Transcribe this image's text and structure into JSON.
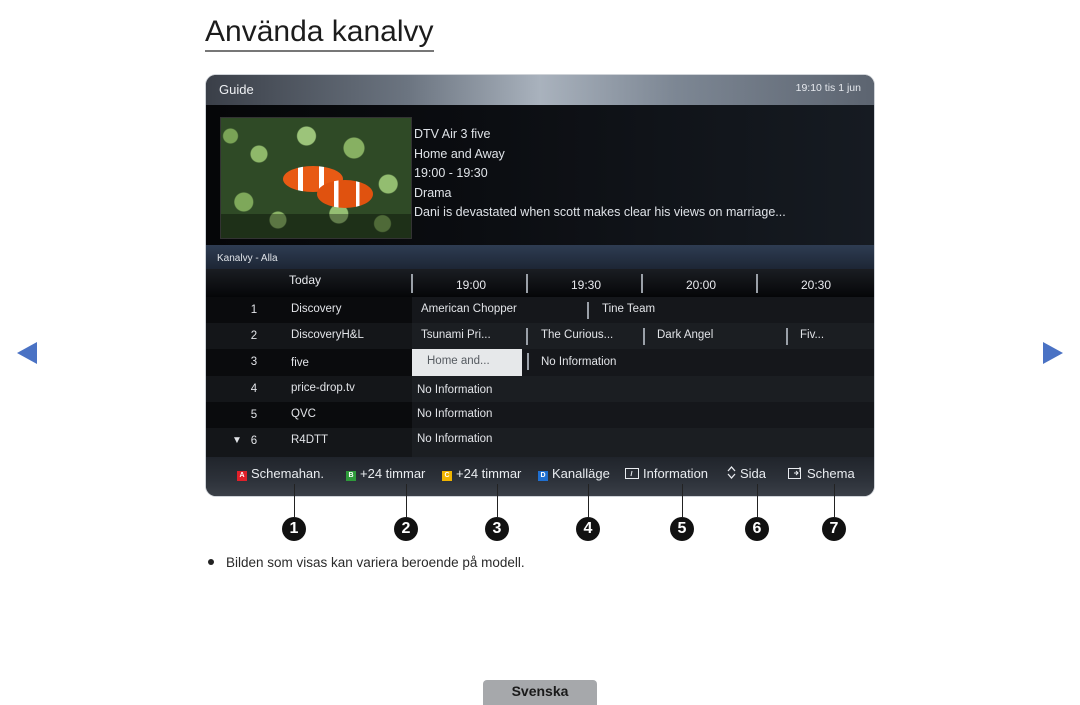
{
  "page": {
    "title": "Använda kanalvy",
    "note": "Bilden som visas kan variera beroende på modell.",
    "language_tab": "Svenska",
    "nav": {
      "prev": "previous-page",
      "next": "next-page"
    }
  },
  "guide": {
    "title": "Guide",
    "clock": "19:10 tis 1 jun",
    "program_info": {
      "channel": "DTV Air 3 five",
      "program": "Home and Away",
      "time": "19:00 - 19:30",
      "genre": "Drama",
      "description": "Dani is devastated when scott makes clear his views on marriage..."
    },
    "list_title": "Kanalvy - Alla",
    "day_label": "Today",
    "times": [
      "19:00",
      "19:30",
      "20:00",
      "20:30"
    ],
    "channels": [
      {
        "num": "1",
        "name": "Discovery",
        "programs": [
          "American Chopper",
          "Tine Team"
        ]
      },
      {
        "num": "2",
        "name": "DiscoveryH&L",
        "programs": [
          "Tsunami Pri...",
          "The Curious...",
          "Dark Angel",
          "Fiv..."
        ]
      },
      {
        "num": "3",
        "name": "five",
        "programs": [
          "Home and...",
          "No Information"
        ]
      },
      {
        "num": "4",
        "name": "price-drop.tv",
        "programs": [
          "No Information"
        ]
      },
      {
        "num": "5",
        "name": "QVC",
        "programs": [
          "No Information"
        ]
      },
      {
        "num": "6",
        "name": "R4DTT",
        "programs": [
          "No Information"
        ],
        "scroll_indicator": "▼"
      }
    ],
    "footer_buttons": [
      {
        "key": "A",
        "key_color": "#e0202a",
        "label": "Schemahan.",
        "callout": "1"
      },
      {
        "key": "B",
        "key_color": "#2e9a3a",
        "label": "+24 timmar",
        "callout": "2"
      },
      {
        "key": "C",
        "key_color": "#f0b400",
        "label": "+24 timmar",
        "callout": "3"
      },
      {
        "key": "D",
        "key_color": "#1f6fd0",
        "label": "Kanalläge",
        "callout": "4"
      },
      {
        "icon": "info-icon",
        "label": "Information",
        "callout": "5"
      },
      {
        "icon": "page-up-down-icon",
        "label": "Sida",
        "callout": "6"
      },
      {
        "icon": "schedule-icon",
        "label": "Schema",
        "callout": "7"
      }
    ]
  }
}
